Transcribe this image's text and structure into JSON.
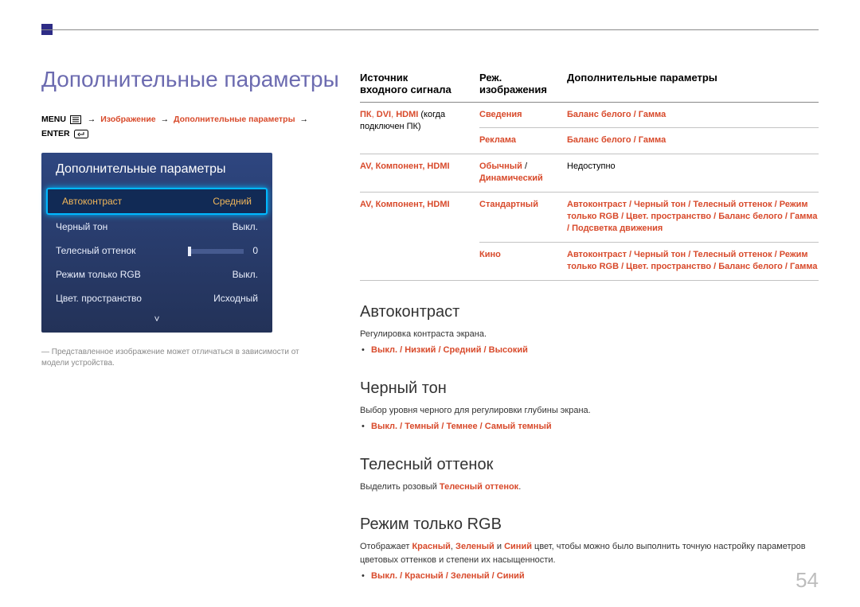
{
  "page_title": "Дополнительные параметры",
  "breadcrumb": {
    "menu_label": "MENU",
    "path1": "Изображение",
    "path2": "Дополнительные параметры",
    "enter_label": "ENTER"
  },
  "osd": {
    "title": "Дополнительные параметры",
    "rows": [
      {
        "label": "Автоконтраст",
        "value": "Средний",
        "selected": true,
        "slider": false
      },
      {
        "label": "Черный тон",
        "value": "Выкл.",
        "selected": false,
        "slider": false
      },
      {
        "label": "Телесный оттенок",
        "value": "0",
        "selected": false,
        "slider": true
      },
      {
        "label": "Режим только RGB",
        "value": "Выкл.",
        "selected": false,
        "slider": false
      },
      {
        "label": "Цвет. пространство",
        "value": "Исходный",
        "selected": false,
        "slider": false
      }
    ],
    "down_glyph": "˅",
    "note_dash": "―",
    "note": "Представленное изображение может отличаться в зависимости от модели устройства."
  },
  "table": {
    "headers": {
      "col1a": "Источник",
      "col1b": "входного сигнала",
      "col2a": "Реж.",
      "col2b": "изображения",
      "col3": "Дополнительные параметры"
    },
    "rows": [
      {
        "src_red": "ПК",
        "src_red2": "DVI",
        "src_red3": "HDMI",
        "src_tail": " (когда подключен ПК)",
        "mode": "Сведения",
        "extra": "Баланс белого / Гамма"
      },
      {
        "src_red": "",
        "mode": "Реклама",
        "extra": "Баланс белого / Гамма"
      },
      {
        "src": "AV, Компонент, HDMI",
        "mode_multi": [
          "Обычный",
          "Динамический"
        ],
        "extra_plain": "Недоступно"
      },
      {
        "src": "AV, Компонент, HDMI",
        "mode": "Стандартный",
        "extra": "Автоконтраст / Черный тон / Телесный оттенок / Режим только RGB / Цвет. пространство / Баланс белого / Гамма / Подсветка движения"
      },
      {
        "src": "",
        "mode": "Кино",
        "extra": "Автоконтраст / Черный тон / Телесный оттенок / Режим только RGB / Цвет. пространство / Баланс белого / Гамма"
      }
    ]
  },
  "sections": {
    "s1": {
      "title": "Автоконтраст",
      "desc": "Регулировка контраста экрана.",
      "opts": "Выкл. / Низкий / Средний / Высокий"
    },
    "s2": {
      "title": "Черный тон",
      "desc": "Выбор уровня черного для регулировки глубины экрана.",
      "opts": "Выкл. / Темный / Темнее / Самый темный"
    },
    "s3": {
      "title": "Телесный оттенок",
      "desc_pre": "Выделить розовый ",
      "desc_red": "Телесный оттенок",
      "desc_post": "."
    },
    "s4": {
      "title": "Режим только RGB",
      "desc_pre": "Отображает ",
      "desc_r": "Красный",
      "desc_g": "Зеленый",
      "desc_b": "Синий",
      "desc_mid1": ", ",
      "desc_mid2": " и ",
      "desc_post": " цвет, чтобы можно было выполнить точную настройку параметров цветовых оттенков и степени их насыщенности.",
      "opts": "Выкл. / Красный / Зеленый / Синий"
    }
  },
  "page_number": "54"
}
